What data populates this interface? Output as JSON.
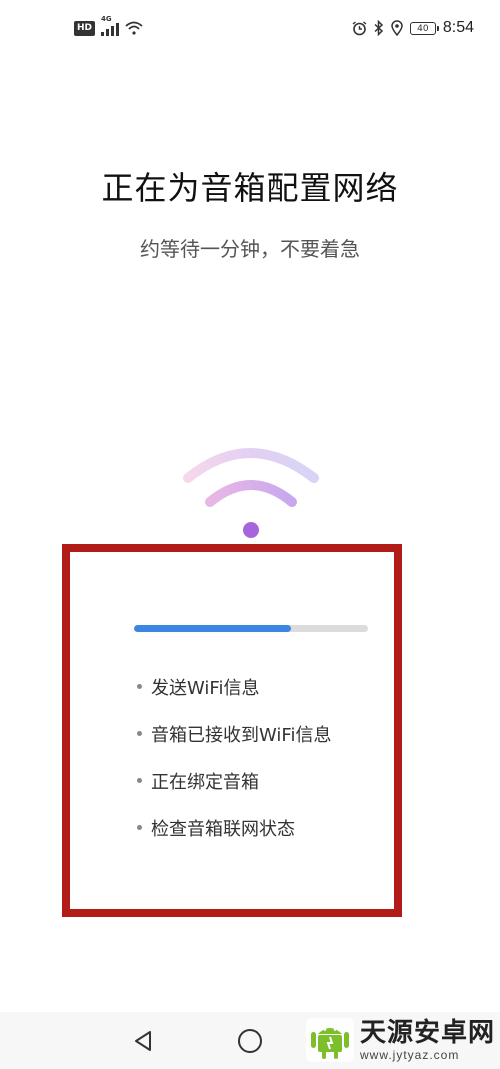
{
  "status_bar": {
    "hd_label": "HD",
    "network_label": "4G",
    "battery_level": "40",
    "time": "8:54",
    "icons": [
      "hd-icon",
      "signal-icon",
      "wifi-icon",
      "alarm-icon",
      "bluetooth-icon",
      "location-icon",
      "battery-icon"
    ]
  },
  "main": {
    "title": "正在为音箱配置网络",
    "subtitle": "约等待一分钟，不要着急"
  },
  "progress": {
    "fraction": 0.67,
    "fill_color": "#3b86e0",
    "track_color": "#dcdcdc",
    "steps": [
      "发送WiFi信息",
      "音箱已接收到WiFi信息",
      "正在绑定音箱",
      "检查音箱联网状态"
    ]
  },
  "highlight_color": "#b11d16",
  "nav_bar": {
    "icons": [
      "back-icon",
      "home-icon"
    ]
  },
  "watermark": {
    "name": "天源安卓网",
    "url": "www.jytyaz.com"
  }
}
